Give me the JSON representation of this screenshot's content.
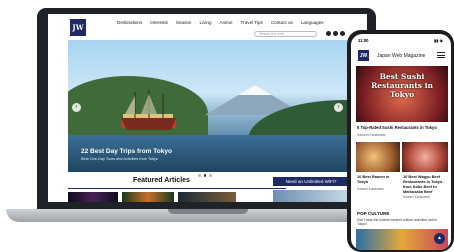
{
  "laptop": {
    "logo": "JW",
    "nav": [
      "Destinations",
      "Interests",
      "Season",
      "Living",
      "Anime",
      "Travel Tips",
      "Contact us",
      "Languages"
    ],
    "search_placeholder": "Search the web",
    "hero": {
      "title": "22 Best Day Trips from Tokyo",
      "subtitle": "Best One-Day Tours and Activities from Tokyo"
    },
    "featured_title": "Featured Articles",
    "wifi_banner": "Need an Unlimited WiFi?"
  },
  "phone": {
    "time": "11:00",
    "status": "▮▮ ◉",
    "logo": "JW",
    "brand": "Japan Web Magazine",
    "hero_text": "Best Sushi Restaurants in Tokyo",
    "article1": "5 Top-Rated Sushi Restaurants in Tokyo",
    "author": "Kanami Kanazawa",
    "article2": "10 Best Ramen in Tokyo",
    "article3": "10 Best Wagyu Beef Restaurants in Tokyo - from Kobe Beef to Matsusaka Beef",
    "author2": "Kanami Kanazawa",
    "author3": "Kanami Kanazawa",
    "pop_title": "POP CULTURE",
    "pop_sub": "Don't miss the hottest modern culture activities and in Tokyo!",
    "fab": "▲"
  }
}
